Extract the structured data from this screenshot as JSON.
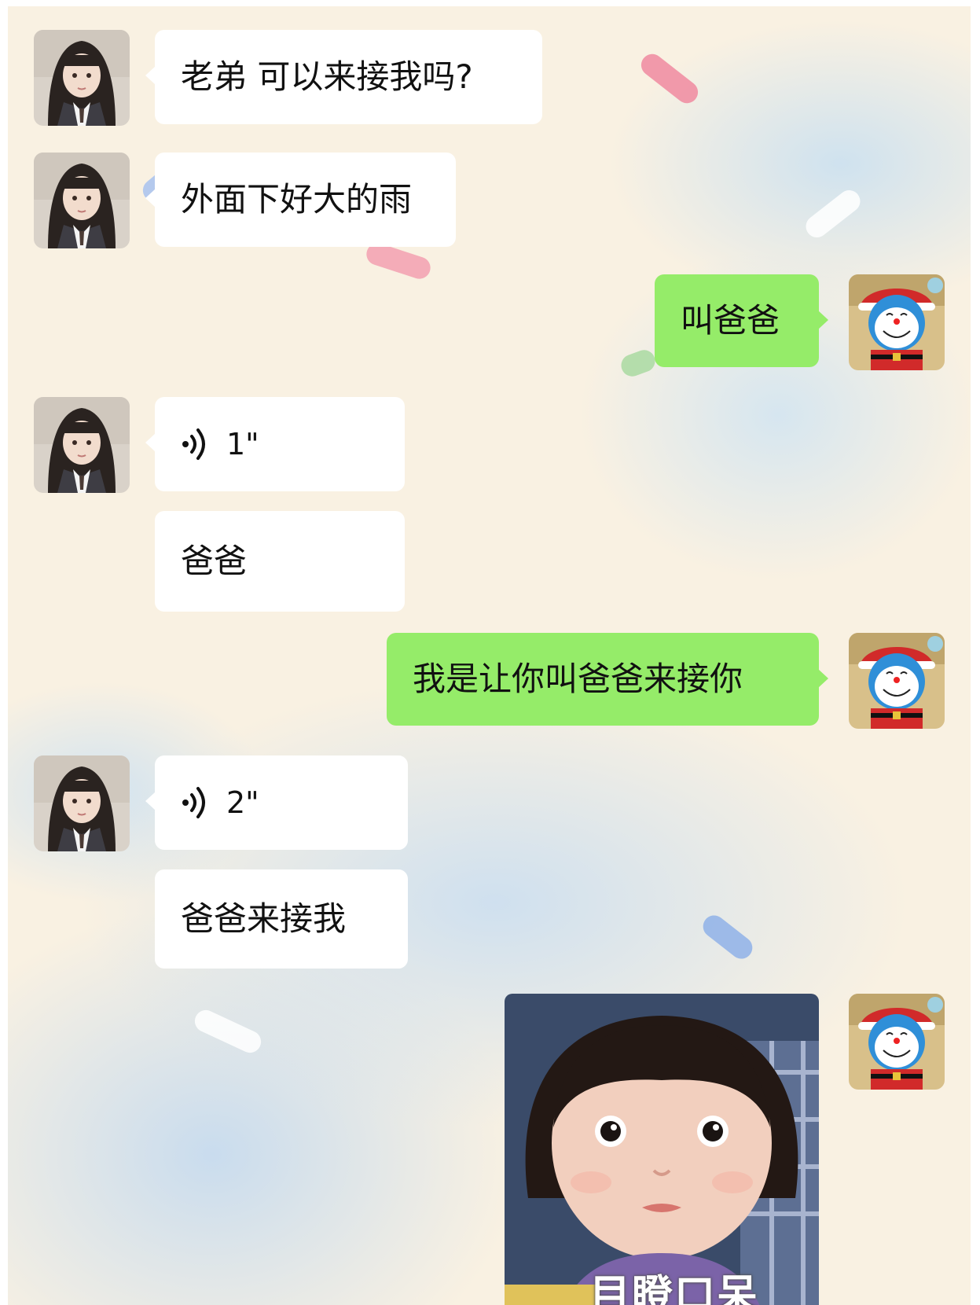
{
  "conversation": {
    "messages": [
      {
        "id": "m1",
        "sender": "friend",
        "type": "text",
        "text": "老弟 可以来接我吗?"
      },
      {
        "id": "m2",
        "sender": "friend",
        "type": "text",
        "text": "外面下好大的雨"
      },
      {
        "id": "m3",
        "sender": "me",
        "type": "text",
        "text": "叫爸爸"
      },
      {
        "id": "m4",
        "sender": "friend",
        "type": "voice",
        "duration": "1\""
      },
      {
        "id": "m5",
        "sender": "friend",
        "type": "text",
        "text": "爸爸"
      },
      {
        "id": "m6",
        "sender": "me",
        "type": "text",
        "text": "我是让你叫爸爸来接你"
      },
      {
        "id": "m7",
        "sender": "friend",
        "type": "voice",
        "duration": "2\""
      },
      {
        "id": "m8",
        "sender": "friend",
        "type": "text",
        "text": "爸爸来接我"
      },
      {
        "id": "m9",
        "sender": "me",
        "type": "sticker",
        "caption": "目瞪口呆"
      }
    ]
  },
  "avatars": {
    "friend": "girl-photo-avatar",
    "me": "doraemon-santa-avatar"
  },
  "icons": {
    "voice": "voice-wave-icon"
  },
  "colors": {
    "background": "#f9f1e2",
    "sky": "#cfe2ef",
    "left_bubble": "#ffffff",
    "right_bubble": "#95ec69",
    "text": "#111111"
  }
}
